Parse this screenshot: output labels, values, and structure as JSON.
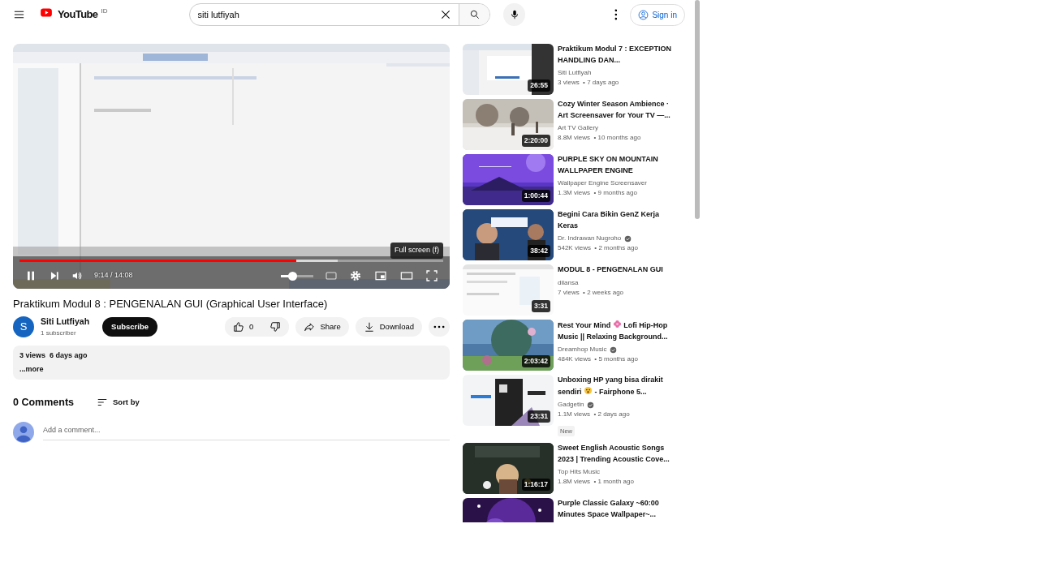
{
  "header": {
    "logo": "YouTube",
    "region": "ID",
    "search": {
      "value": "siti lutfiyah"
    },
    "sign_in": "Sign in"
  },
  "player": {
    "tooltip": "Full screen (f)",
    "progress": {
      "level": 0.653
    },
    "buffered": {
      "level": 0.75
    },
    "volume": {
      "level": 0.35
    },
    "time": "9:14 / 14:08",
    "playing": true
  },
  "video": {
    "title": "Praktikum Modul 8 : PENGENALAN GUI (Graphical User Interface)",
    "channel": {
      "avatar": "S",
      "name": "Siti Lutfiyah",
      "subscribers": "1 subscriber"
    },
    "subscribe": "Subscribe",
    "likes": "0",
    "share": "Share",
    "download": "Download"
  },
  "description": {
    "stats": "3 views  6 days ago",
    "more": "...more"
  },
  "comments": {
    "count": "0 Comments",
    "sort": "Sort by",
    "placeholder": "Add a comment..."
  },
  "recommendations": [
    {
      "duration": "26:55",
      "title": [
        "Praktikum Modul 7 : EXCEPTION HANDLING DAN..."
      ],
      "channel": "Siti Lutfiyah",
      "verified": false,
      "meta": "3 views  • 7 days ago"
    },
    {
      "duration": "2:20:00",
      "title": [
        "Cozy Winter Season Ambience · Art Screensaver for Your TV —..."
      ],
      "channel": "Art TV Gallery",
      "verified": false,
      "meta": "8.8M views  • 10 months ago"
    },
    {
      "duration": "1:00:44",
      "title": [
        "PURPLE SKY ON MOUNTAIN WALLPAPER ENGINE"
      ],
      "channel": "Wallpaper Engine Screensaver",
      "verified": false,
      "meta": "1.3M views  • 9 months ago"
    },
    {
      "duration": "38:42",
      "title": [
        "Begini Cara Bikin GenZ Kerja Keras"
      ],
      "channel": "Dr. Indrawan Nugroho",
      "verified": true,
      "meta": "542K views  • 2 months ago"
    },
    {
      "duration": "3:31",
      "title": [
        "MODUL 8 - PENGENALAN GUI"
      ],
      "channel": "dilansa",
      "verified": false,
      "meta": "7 views  • 2 weeks ago"
    },
    {
      "duration": "2:03:42",
      "title": [
        "Rest Your Mind",
        "Lofi Hip-Hop Music || Relaxing Background..."
      ],
      "channel": "Dreamhop Music",
      "verified": true,
      "meta": "484K views  • 5 months ago"
    },
    {
      "duration": "23:31",
      "title": [
        "Unboxing HP yang bisa dirakit sendiri",
        "- Fairphone 5..."
      ],
      "channel": "Gadgetin",
      "verified": true,
      "meta": "1.1M views  • 2 days ago",
      "badge": "New"
    },
    {
      "duration": "1:16:17",
      "title": [
        "Sweet English Acoustic Songs 2023 | Trending Acoustic Cove..."
      ],
      "channel": "Top Hits Music",
      "verified": false,
      "meta": "1.8M views  • 1 month ago"
    },
    {
      "title": [
        "Purple Classic Galaxy ~60:00 Minutes Space Wallpaper~..."
      ]
    }
  ]
}
